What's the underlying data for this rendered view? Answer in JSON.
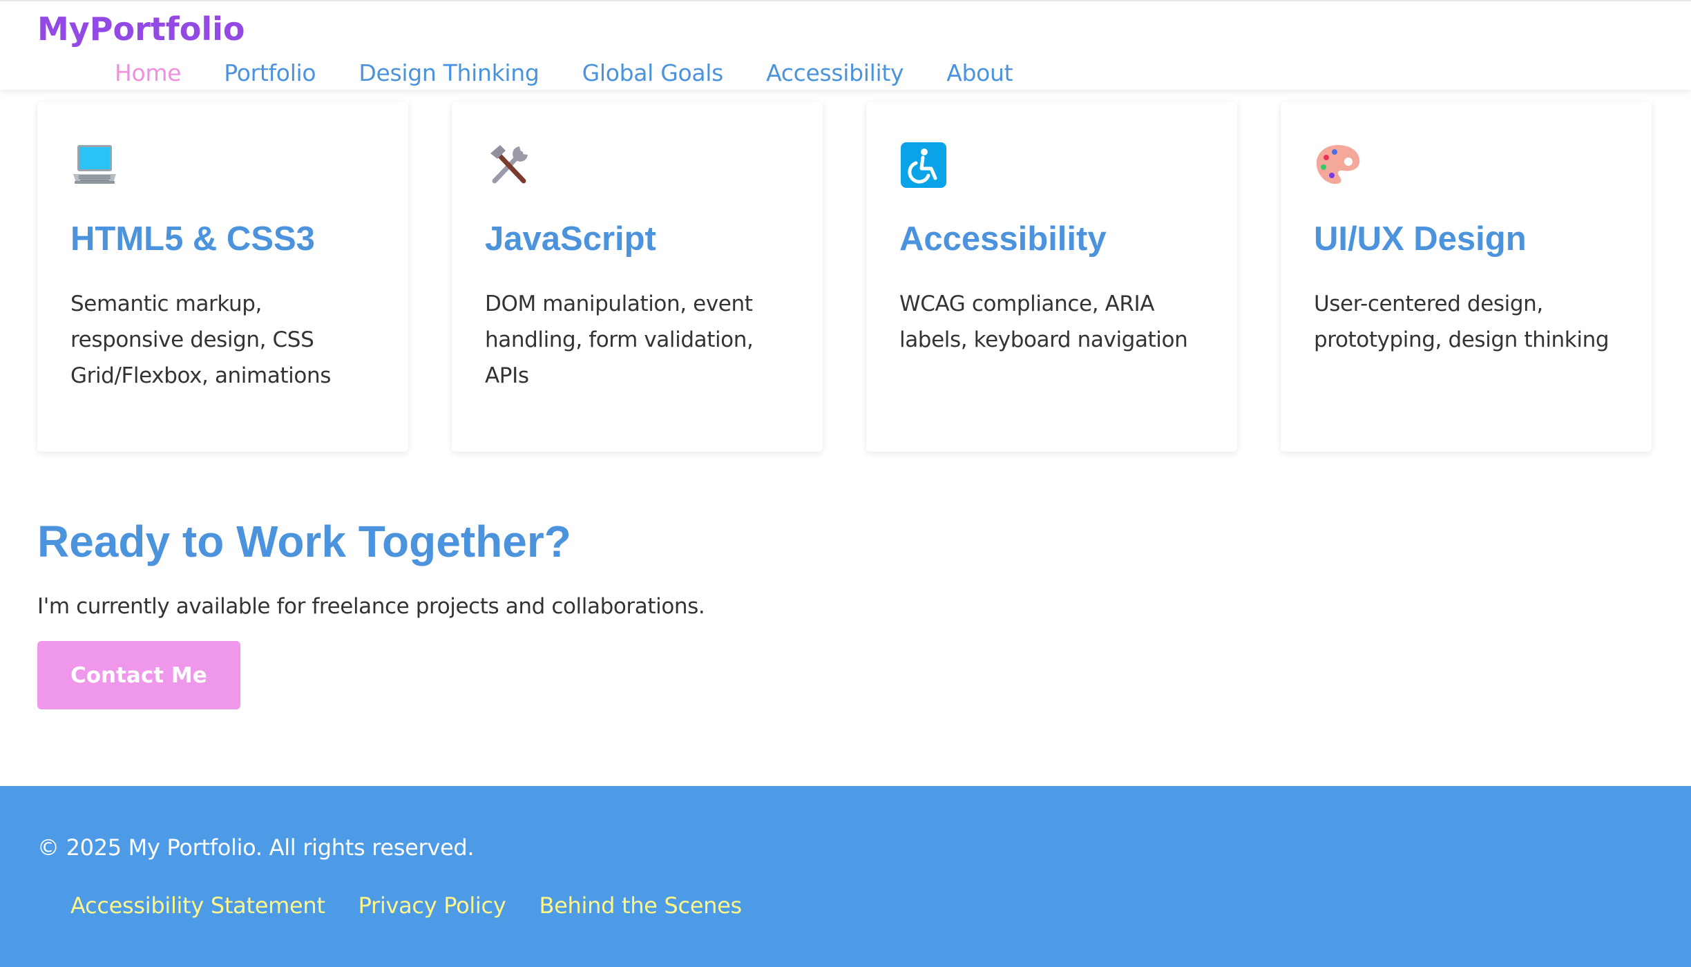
{
  "header": {
    "logo": "MyPortfolio",
    "nav": [
      {
        "label": "Home",
        "active": true
      },
      {
        "label": "Portfolio",
        "active": false
      },
      {
        "label": "Design Thinking",
        "active": false
      },
      {
        "label": "Global Goals",
        "active": false
      },
      {
        "label": "Accessibility",
        "active": false
      },
      {
        "label": "About",
        "active": false
      }
    ]
  },
  "skills": [
    {
      "icon": "laptop-icon",
      "title": "HTML5 & CSS3",
      "description": "Semantic markup, responsive design, CSS Grid/Flexbox, animations"
    },
    {
      "icon": "hammer-and-wrench-icon",
      "title": "JavaScript",
      "description": "DOM manipulation, event handling, form validation, APIs"
    },
    {
      "icon": "wheelchair-icon",
      "title": "Accessibility",
      "description": "WCAG compliance, ARIA labels, keyboard navigation"
    },
    {
      "icon": "artist-palette-icon",
      "title": "UI/UX Design",
      "description": "User-centered design, prototyping, design thinking"
    }
  ],
  "cta": {
    "title": "Ready to Work Together?",
    "text": "I'm currently available for freelance projects and collaborations.",
    "button_label": "Contact Me"
  },
  "footer": {
    "copyright": "© 2025 My Portfolio. All rights reserved.",
    "links": [
      "Accessibility Statement",
      "Privacy Policy",
      "Behind the Scenes"
    ]
  },
  "colors": {
    "brand": "#9349e3",
    "link": "#4b93dc",
    "active_nav": "#f08fe0",
    "button": "#ef98eb",
    "footer_bg": "#4d9be6",
    "footer_link": "#fff68a"
  }
}
